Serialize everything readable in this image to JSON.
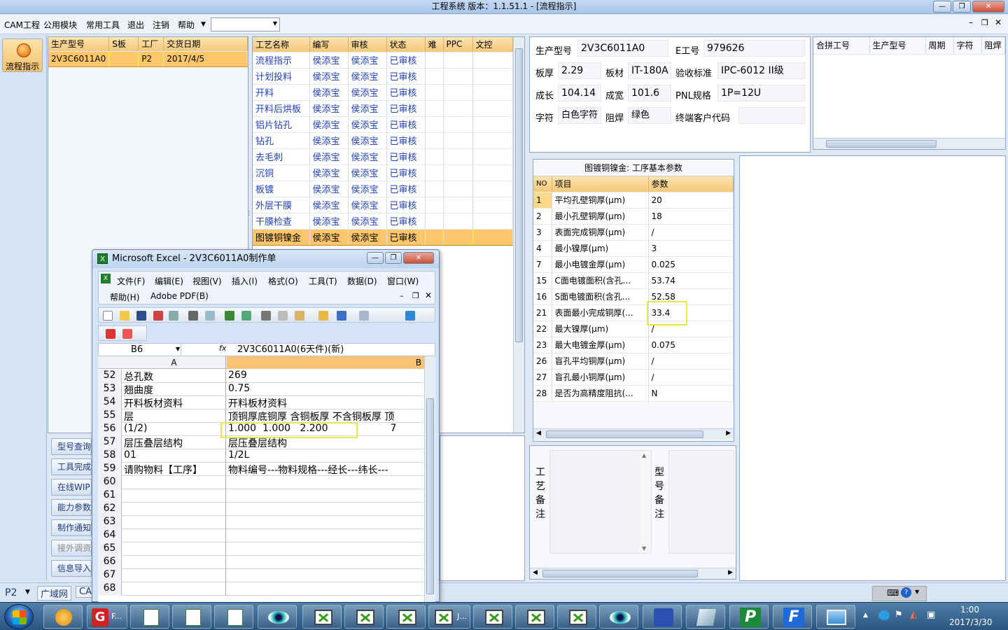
{
  "window": {
    "title": "工程系统   版本：1.1.51.1 - [流程指示]"
  },
  "menu": {
    "items": [
      "CAM工程",
      "公用模块",
      "常用工具",
      "退出",
      "注销",
      "帮助"
    ]
  },
  "nav": {
    "active_label": "流程指示"
  },
  "orders": {
    "headers": [
      "生产型号",
      "S板",
      "工厂",
      "交货日期"
    ],
    "rows": [
      {
        "model": "2V3C6011A0",
        "s": "",
        "factory": "P2",
        "date": "2017/4/5"
      }
    ]
  },
  "sidebuttons": [
    "型号查询",
    "工具完成",
    "在线WIP",
    "能力参数",
    "制作通知",
    "接外调资",
    "信息导入"
  ],
  "process": {
    "headers": [
      "工艺名称",
      "编写",
      "审核",
      "状态",
      "难",
      "PPC",
      "文控"
    ],
    "rows": [
      {
        "name": "流程指示",
        "author": "侯添宝",
        "reviewer": "侯添宝",
        "status": "已审核"
      },
      {
        "name": "计划投料",
        "author": "侯添宝",
        "reviewer": "侯添宝",
        "status": "已审核"
      },
      {
        "name": "开料",
        "author": "侯添宝",
        "reviewer": "侯添宝",
        "status": "已审核"
      },
      {
        "name": "开料后烘板",
        "author": "侯添宝",
        "reviewer": "侯添宝",
        "status": "已审核"
      },
      {
        "name": "铝片钻孔",
        "author": "侯添宝",
        "reviewer": "侯添宝",
        "status": "已审核"
      },
      {
        "name": "钻孔",
        "author": "侯添宝",
        "reviewer": "侯添宝",
        "status": "已审核"
      },
      {
        "name": "去毛刺",
        "author": "侯添宝",
        "reviewer": "侯添宝",
        "status": "已审核"
      },
      {
        "name": "沉铜",
        "author": "侯添宝",
        "reviewer": "侯添宝",
        "status": "已审核"
      },
      {
        "name": "板镀",
        "author": "侯添宝",
        "reviewer": "侯添宝",
        "status": "已审核"
      },
      {
        "name": "外层干膜",
        "author": "侯添宝",
        "reviewer": "侯添宝",
        "status": "已审核"
      },
      {
        "name": "干膜检查",
        "author": "侯添宝",
        "reviewer": "侯添宝",
        "status": "已审核"
      },
      {
        "name": "图镀铜镍金",
        "author": "侯添宝",
        "reviewer": "侯添宝",
        "status": "已审核"
      }
    ]
  },
  "info": {
    "model_label": "生产型号",
    "model": "2V3C6011A0",
    "e_label": "E工号",
    "e": "979626",
    "thick_label": "板厚",
    "thick": "2.29",
    "material_label": "板材",
    "material": "IT-180A",
    "std_label": "验收标准",
    "std": "IPC-6012 II级",
    "len_label": "成长",
    "len": "104.14",
    "wid_label": "成宽",
    "wid": "101.6",
    "pnl_label": "PNL规格",
    "pnl": "1P=12U",
    "char_label": "字符",
    "char": "白色字符",
    "mask_label": "阻焊",
    "mask": "绿色",
    "client_label": "终端客户代码",
    "client": ""
  },
  "merge": {
    "headers": [
      "合拼工号",
      "生产型号",
      "周期",
      "字符",
      "阻焊"
    ]
  },
  "params": {
    "title": "图镀铜镍金: 工序基本参数",
    "headers": [
      "NO",
      "项目",
      "参数"
    ],
    "rows": [
      {
        "no": "1",
        "item": "平均孔壁铜厚(μm)",
        "val": "20"
      },
      {
        "no": "2",
        "item": "最小孔壁铜厚(μm)",
        "val": "18"
      },
      {
        "no": "3",
        "item": "表面完成铜厚(μm)",
        "val": "/"
      },
      {
        "no": "4",
        "item": "最小镍厚(μm)",
        "val": "3"
      },
      {
        "no": "7",
        "item": "最小电镀金厚(μm)",
        "val": "0.025"
      },
      {
        "no": "15",
        "item": "C面电镀面积(含孔...",
        "val": "53.74"
      },
      {
        "no": "16",
        "item": "S面电镀面积(含孔...",
        "val": "52.58"
      },
      {
        "no": "21",
        "item": "表面最小完成铜厚(...",
        "val": "33.4"
      },
      {
        "no": "22",
        "item": "最大镍厚(μm)",
        "val": "/"
      },
      {
        "no": "23",
        "item": "最大电镀金厚(μm)",
        "val": "0.075"
      },
      {
        "no": "26",
        "item": "盲孔平均铜厚(μm)",
        "val": "/"
      },
      {
        "no": "27",
        "item": "盲孔最小铜厚(μm)",
        "val": "/"
      },
      {
        "no": "28",
        "item": "是否为高精度阻抗(...",
        "val": "N"
      }
    ]
  },
  "notes": {
    "process_label": "工艺备注",
    "model_label": "型号备注"
  },
  "status": {
    "left": "P2",
    "net": "广域网",
    "cam": "CA"
  },
  "excel": {
    "title": "Microsoft Excel - 2V3C6011A0制作单",
    "menu1": [
      "文件(F)",
      "编辑(E)",
      "视图(V)",
      "插入(I)",
      "格式(O)",
      "工具(T)",
      "数据(D)",
      "窗口(W)"
    ],
    "menu2": [
      "帮助(H)",
      "Adobe PDF(B)"
    ],
    "namebox": "B6",
    "fx": "fx",
    "formula": "2V3C6011A0(6天件)(新)",
    "colA": "A",
    "colB": "B",
    "rows": [
      {
        "n": "52",
        "a": "总孔数",
        "b": "269"
      },
      {
        "n": "53",
        "a": "翘曲度",
        "b": "0.75"
      },
      {
        "n": "54",
        "a": "开料板材资料",
        "b": "开料板材资料"
      },
      {
        "n": "55",
        "a": "层",
        "b": "顶铜厚底铜厚 含铜板厚 不含铜板厚 顶"
      },
      {
        "n": "56",
        "a": "(1/2)",
        "b": "1.000  1.000   2.200                    7"
      },
      {
        "n": "57",
        "a": "层压叠层结构",
        "b": "层压叠层结构"
      },
      {
        "n": "58",
        "a": "01",
        "b": "1/2L"
      },
      {
        "n": "59",
        "a": "请购物料【工序】",
        "b": "物料编号---物料规格---经长---纬长---"
      },
      {
        "n": "60",
        "a": "",
        "b": ""
      },
      {
        "n": "61",
        "a": "",
        "b": ""
      },
      {
        "n": "62",
        "a": "",
        "b": ""
      },
      {
        "n": "63",
        "a": "",
        "b": ""
      },
      {
        "n": "64",
        "a": "",
        "b": ""
      },
      {
        "n": "65",
        "a": "",
        "b": ""
      },
      {
        "n": "66",
        "a": "",
        "b": ""
      },
      {
        "n": "67",
        "a": "",
        "b": ""
      },
      {
        "n": "68",
        "a": "",
        "b": ""
      }
    ]
  },
  "taskbar": {
    "time": "1:00",
    "date": "2017/3/30",
    "item_f": "F...",
    "item_j": "J..."
  }
}
